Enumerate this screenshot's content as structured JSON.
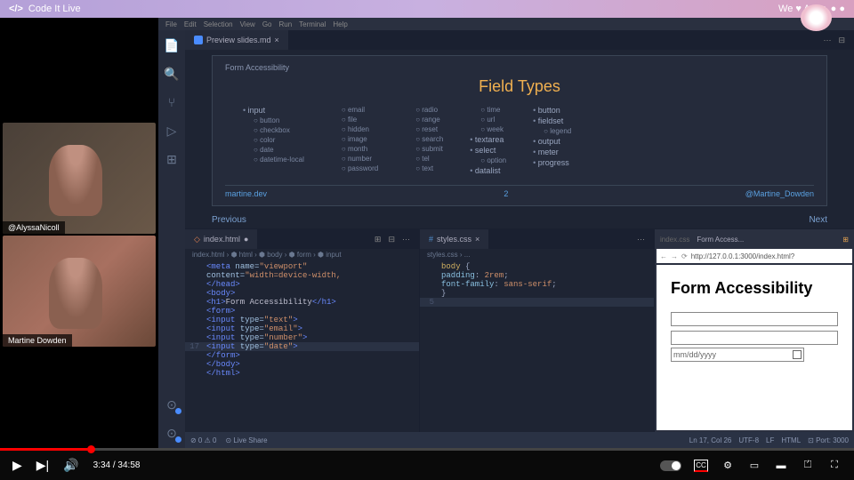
{
  "header": {
    "brand_icon": "</>",
    "brand_text": "Code It Live",
    "right_text": "We ♥ A11y",
    "right_dots": "● ●"
  },
  "webcams": [
    {
      "label": "@AlyssaNicoll"
    },
    {
      "label": "Martine Dowden"
    }
  ],
  "menu": [
    "File",
    "Edit",
    "Selection",
    "View",
    "Go",
    "Run",
    "Terminal",
    "Help"
  ],
  "main_tab": {
    "label": "Preview slides.md"
  },
  "slide": {
    "crumb": "Form Accessibility",
    "title": "Field Types",
    "col1_head": "input",
    "col1": [
      "button",
      "checkbox",
      "color",
      "date",
      "datetime-local"
    ],
    "col2": [
      "email",
      "file",
      "hidden",
      "image",
      "month",
      "number",
      "password"
    ],
    "col3": [
      "radio",
      "range",
      "reset",
      "search",
      "submit",
      "tel",
      "text"
    ],
    "col4": [
      "time",
      "url",
      "week"
    ],
    "col4b": [
      "textarea",
      "select"
    ],
    "col4b_sub": "option",
    "col4c": "datalist",
    "col5": [
      "button",
      "fieldset"
    ],
    "col5_sub": "legend",
    "col5b": [
      "output",
      "meter",
      "progress"
    ],
    "footer_left": "martine.dev",
    "footer_mid": "2",
    "footer_right": "@Martine_Dowden",
    "nav_prev": "Previous",
    "nav_next": "Next"
  },
  "code_left": {
    "tab": "index.html",
    "breadcrumb": "index.html › ⬢ html › ⬢ body › ⬢ form › ⬢ input",
    "lines": [
      {
        "n": "",
        "html": "<span class='tag-c'>&lt;meta</span> <span class='attr-c'>name=</span><span class='str-c'>\"viewport\"</span> <span class='attr-c'>content=</span><span class='str-c'>\"width=device-width,</span>"
      },
      {
        "n": "",
        "html": "<span class='tag-c'>&lt;/head&gt;</span>"
      },
      {
        "n": "",
        "html": "<span class='tag-c'>&lt;body&gt;</span>"
      },
      {
        "n": "",
        "html": "  <span class='tag-c'>&lt;h1&gt;</span><span class='txt-c'>Form Accessibility</span><span class='tag-c'>&lt;/h1&gt;</span>"
      },
      {
        "n": "",
        "html": "  <span class='tag-c'>&lt;form&gt;</span>"
      },
      {
        "n": "",
        "html": "    <span class='tag-c'>&lt;input</span> <span class='attr-c'>type=</span><span class='str-c'>\"text\"</span><span class='tag-c'>&gt;</span>"
      },
      {
        "n": "",
        "html": ""
      },
      {
        "n": "",
        "html": "    <span class='tag-c'>&lt;input</span> <span class='attr-c'>type=</span><span class='str-c'>\"email\"</span><span class='tag-c'>&gt;</span>"
      },
      {
        "n": "",
        "html": ""
      },
      {
        "n": "",
        "html": "    <span class='tag-c'>&lt;input</span> <span class='attr-c'>type=</span><span class='str-c'>\"number\"</span><span class='tag-c'>&gt;</span>"
      },
      {
        "n": "",
        "html": ""
      },
      {
        "n": "17",
        "html": "    <span class='tag-c'>&lt;input</span> <span class='attr-c'>type=</span><span class='str-c'>\"date\"</span><span class='tag-c'>&gt;</span>",
        "hl": true
      },
      {
        "n": "",
        "html": "  <span class='tag-c'>&lt;/form&gt;</span>"
      },
      {
        "n": "",
        "html": "<span class='tag-c'>&lt;/body&gt;</span>"
      },
      {
        "n": "",
        "html": "<span class='tag-c'>&lt;/html&gt;</span>"
      }
    ]
  },
  "code_right": {
    "tab": "styles.css",
    "breadcrumb": "styles.css › ...",
    "lines": [
      {
        "n": "",
        "html": "<span class='sel-c'>body</span> {"
      },
      {
        "n": "",
        "html": "  <span class='prop-c'>padding</span>: <span class='str-c'>2rem</span>;"
      },
      {
        "n": "",
        "html": "  <span class='prop-c'>font-family</span>: <span class='str-c'>sans-serif</span>;"
      },
      {
        "n": "",
        "html": "}"
      },
      {
        "n": "5",
        "html": "",
        "hl": true
      }
    ]
  },
  "browser": {
    "tab1": "index.css",
    "tab2": "Form Access...",
    "url": "http://127.0.0.1:3000/index.html?",
    "page_title": "Form Accessibility",
    "date_placeholder": "mm/dd/yyyy"
  },
  "status": {
    "left1": "⊘ 0 ⚠ 0",
    "left2": "⊙ Live Share",
    "r1": "Ln 17, Col 26",
    "r2": "UTF-8",
    "r3": "LF",
    "r4": "HTML",
    "r5": "⊡ Port: 3000"
  },
  "video": {
    "time": "3:34 / 34:58"
  }
}
